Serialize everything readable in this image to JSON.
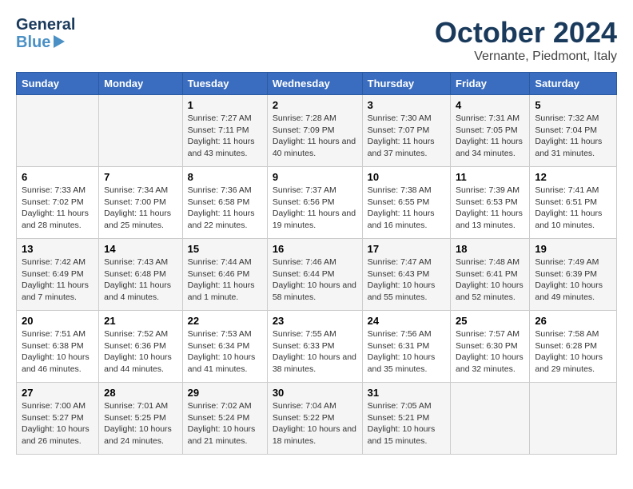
{
  "header": {
    "logo_line1": "General",
    "logo_line2": "Blue",
    "month": "October 2024",
    "location": "Vernante, Piedmont, Italy"
  },
  "days_of_week": [
    "Sunday",
    "Monday",
    "Tuesday",
    "Wednesday",
    "Thursday",
    "Friday",
    "Saturday"
  ],
  "weeks": [
    [
      {
        "num": "",
        "info": ""
      },
      {
        "num": "",
        "info": ""
      },
      {
        "num": "1",
        "info": "Sunrise: 7:27 AM\nSunset: 7:11 PM\nDaylight: 11 hours and 43 minutes."
      },
      {
        "num": "2",
        "info": "Sunrise: 7:28 AM\nSunset: 7:09 PM\nDaylight: 11 hours and 40 minutes."
      },
      {
        "num": "3",
        "info": "Sunrise: 7:30 AM\nSunset: 7:07 PM\nDaylight: 11 hours and 37 minutes."
      },
      {
        "num": "4",
        "info": "Sunrise: 7:31 AM\nSunset: 7:05 PM\nDaylight: 11 hours and 34 minutes."
      },
      {
        "num": "5",
        "info": "Sunrise: 7:32 AM\nSunset: 7:04 PM\nDaylight: 11 hours and 31 minutes."
      }
    ],
    [
      {
        "num": "6",
        "info": "Sunrise: 7:33 AM\nSunset: 7:02 PM\nDaylight: 11 hours and 28 minutes."
      },
      {
        "num": "7",
        "info": "Sunrise: 7:34 AM\nSunset: 7:00 PM\nDaylight: 11 hours and 25 minutes."
      },
      {
        "num": "8",
        "info": "Sunrise: 7:36 AM\nSunset: 6:58 PM\nDaylight: 11 hours and 22 minutes."
      },
      {
        "num": "9",
        "info": "Sunrise: 7:37 AM\nSunset: 6:56 PM\nDaylight: 11 hours and 19 minutes."
      },
      {
        "num": "10",
        "info": "Sunrise: 7:38 AM\nSunset: 6:55 PM\nDaylight: 11 hours and 16 minutes."
      },
      {
        "num": "11",
        "info": "Sunrise: 7:39 AM\nSunset: 6:53 PM\nDaylight: 11 hours and 13 minutes."
      },
      {
        "num": "12",
        "info": "Sunrise: 7:41 AM\nSunset: 6:51 PM\nDaylight: 11 hours and 10 minutes."
      }
    ],
    [
      {
        "num": "13",
        "info": "Sunrise: 7:42 AM\nSunset: 6:49 PM\nDaylight: 11 hours and 7 minutes."
      },
      {
        "num": "14",
        "info": "Sunrise: 7:43 AM\nSunset: 6:48 PM\nDaylight: 11 hours and 4 minutes."
      },
      {
        "num": "15",
        "info": "Sunrise: 7:44 AM\nSunset: 6:46 PM\nDaylight: 11 hours and 1 minute."
      },
      {
        "num": "16",
        "info": "Sunrise: 7:46 AM\nSunset: 6:44 PM\nDaylight: 10 hours and 58 minutes."
      },
      {
        "num": "17",
        "info": "Sunrise: 7:47 AM\nSunset: 6:43 PM\nDaylight: 10 hours and 55 minutes."
      },
      {
        "num": "18",
        "info": "Sunrise: 7:48 AM\nSunset: 6:41 PM\nDaylight: 10 hours and 52 minutes."
      },
      {
        "num": "19",
        "info": "Sunrise: 7:49 AM\nSunset: 6:39 PM\nDaylight: 10 hours and 49 minutes."
      }
    ],
    [
      {
        "num": "20",
        "info": "Sunrise: 7:51 AM\nSunset: 6:38 PM\nDaylight: 10 hours and 46 minutes."
      },
      {
        "num": "21",
        "info": "Sunrise: 7:52 AM\nSunset: 6:36 PM\nDaylight: 10 hours and 44 minutes."
      },
      {
        "num": "22",
        "info": "Sunrise: 7:53 AM\nSunset: 6:34 PM\nDaylight: 10 hours and 41 minutes."
      },
      {
        "num": "23",
        "info": "Sunrise: 7:55 AM\nSunset: 6:33 PM\nDaylight: 10 hours and 38 minutes."
      },
      {
        "num": "24",
        "info": "Sunrise: 7:56 AM\nSunset: 6:31 PM\nDaylight: 10 hours and 35 minutes."
      },
      {
        "num": "25",
        "info": "Sunrise: 7:57 AM\nSunset: 6:30 PM\nDaylight: 10 hours and 32 minutes."
      },
      {
        "num": "26",
        "info": "Sunrise: 7:58 AM\nSunset: 6:28 PM\nDaylight: 10 hours and 29 minutes."
      }
    ],
    [
      {
        "num": "27",
        "info": "Sunrise: 7:00 AM\nSunset: 5:27 PM\nDaylight: 10 hours and 26 minutes."
      },
      {
        "num": "28",
        "info": "Sunrise: 7:01 AM\nSunset: 5:25 PM\nDaylight: 10 hours and 24 minutes."
      },
      {
        "num": "29",
        "info": "Sunrise: 7:02 AM\nSunset: 5:24 PM\nDaylight: 10 hours and 21 minutes."
      },
      {
        "num": "30",
        "info": "Sunrise: 7:04 AM\nSunset: 5:22 PM\nDaylight: 10 hours and 18 minutes."
      },
      {
        "num": "31",
        "info": "Sunrise: 7:05 AM\nSunset: 5:21 PM\nDaylight: 10 hours and 15 minutes."
      },
      {
        "num": "",
        "info": ""
      },
      {
        "num": "",
        "info": ""
      }
    ]
  ]
}
